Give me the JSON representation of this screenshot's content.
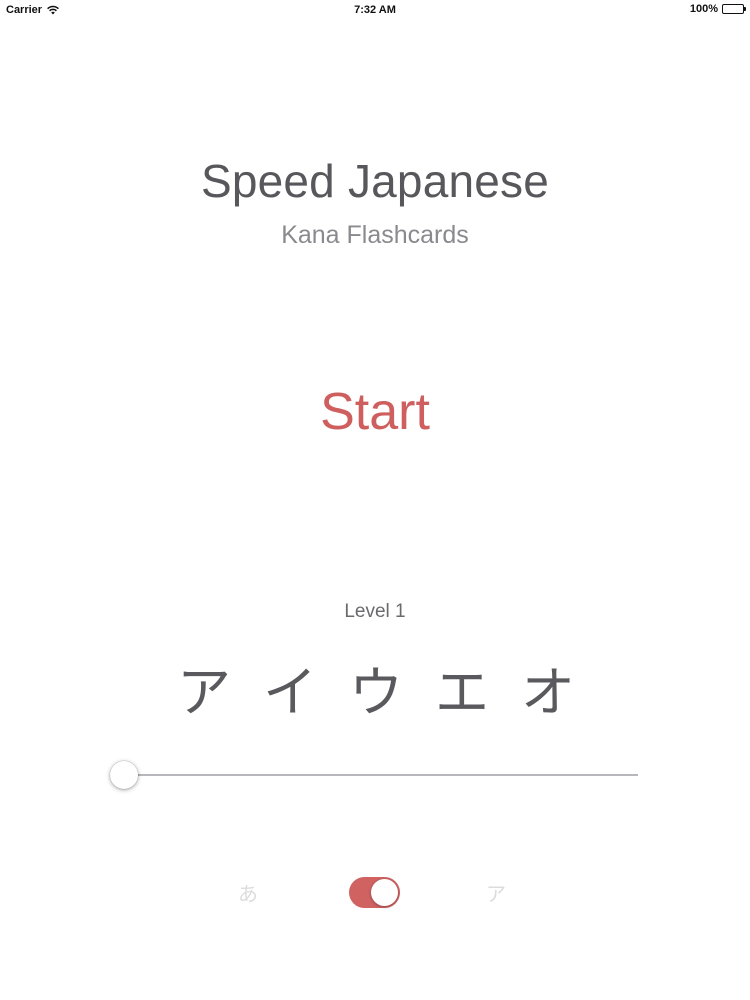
{
  "status_bar": {
    "carrier": "Carrier",
    "time": "7:32 AM",
    "battery": "100%",
    "battery_level": 1.0,
    "icons": {
      "wifi": "wifi-icon",
      "battery": "battery-icon"
    }
  },
  "header": {
    "title": "Speed Japanese",
    "subtitle": "Kana Flashcards"
  },
  "start_button": {
    "label": "Start",
    "color": "#cf5f5f"
  },
  "level": {
    "label": "Level 1",
    "kana": [
      "ア",
      "イ",
      "ウ",
      "エ",
      "オ"
    ],
    "slider_value": 0.0
  },
  "mode_toggle": {
    "hiragana_label": "あ",
    "katakana_label": "ア",
    "is_on": true,
    "on_color": "#d06262"
  }
}
